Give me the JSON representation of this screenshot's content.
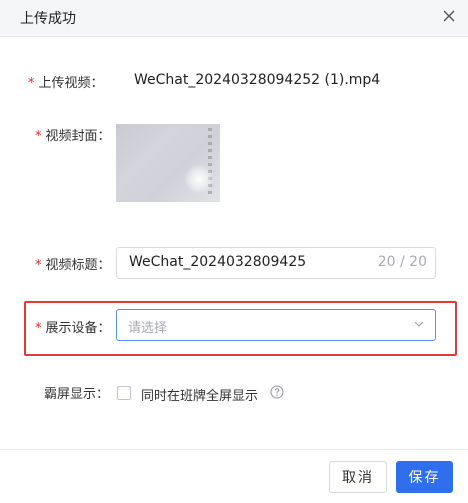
{
  "dialog": {
    "title": "上传成功"
  },
  "form": {
    "video": {
      "required_mark": "*",
      "label": "上传视频：",
      "file_name": "WeChat_20240328094252 (1).mp4"
    },
    "cover": {
      "required_mark": "*",
      "label": "视频封面："
    },
    "title": {
      "required_mark": "*",
      "label": "视频标题：",
      "value": "WeChat_2024032809425",
      "count": "20 / 20"
    },
    "device": {
      "required_mark": "*",
      "label": "展示设备：",
      "placeholder": "请选择"
    },
    "fullscreen": {
      "label": "霸屏显示：",
      "checkbox_label": "同时在班牌全屏显示",
      "checked": false
    }
  },
  "footer": {
    "cancel_label": "取消",
    "save_label": "保存"
  },
  "colors": {
    "primary": "#2f6fed",
    "required": "#f5222d",
    "highlight": "#e53935"
  }
}
